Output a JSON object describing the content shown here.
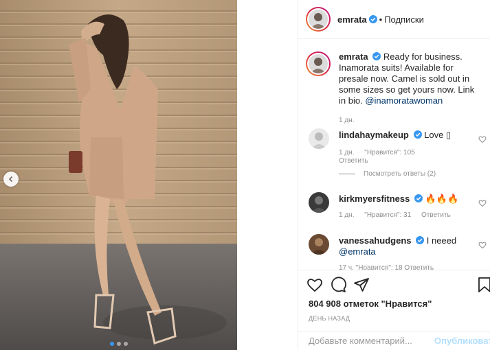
{
  "post": {
    "photo": {
      "dots_count": 3,
      "active_dot": 0
    }
  },
  "header": {
    "username": "emrata",
    "separator": "•",
    "follow_status": "Подписки"
  },
  "caption": {
    "username": "emrata",
    "text": "Ready for business. Inamorata suits! Available for presale now. Camel is sold out in some sizes so get yours now. Link in bio.",
    "mention": "@inamoratawoman",
    "time": "1 дн."
  },
  "comments": [
    {
      "username": "lindahaymakeup",
      "text": "Love ",
      "emoji": "▯",
      "time": "1 дн.",
      "likes": "\"Нравится\": 105",
      "reply_label": "Ответить",
      "view_replies": "Посмотреть ответы (2)"
    },
    {
      "username": "kirkmyersfitness",
      "text": "",
      "emoji": "🔥🔥🔥",
      "time": "1 дн.",
      "likes": "\"Нравится\": 31",
      "reply_label": "Ответить"
    },
    {
      "username": "vanessahudgens",
      "text": "I neeed",
      "mention": "@emrata",
      "partial_meta": "17 ч.   \"Нравится\": 18   Ответить"
    }
  ],
  "actions": {
    "likes_text": "804 908 отметок \"Нравится\"",
    "post_time": "ДЕНЬ НАЗАД",
    "comment_placeholder": "Добавьте комментарий...",
    "publish_label": "Опубликовать"
  },
  "colors": {
    "accent": "#3897f0",
    "verified": "#3897f0",
    "publish_disabled": "#b2dffc",
    "meta_gray": "#8e8e8e"
  },
  "icons": [
    "verified-badge-icon",
    "heart-icon",
    "comment-icon",
    "share-icon",
    "bookmark-icon",
    "chevron-left-icon",
    "small-heart-icon"
  ]
}
